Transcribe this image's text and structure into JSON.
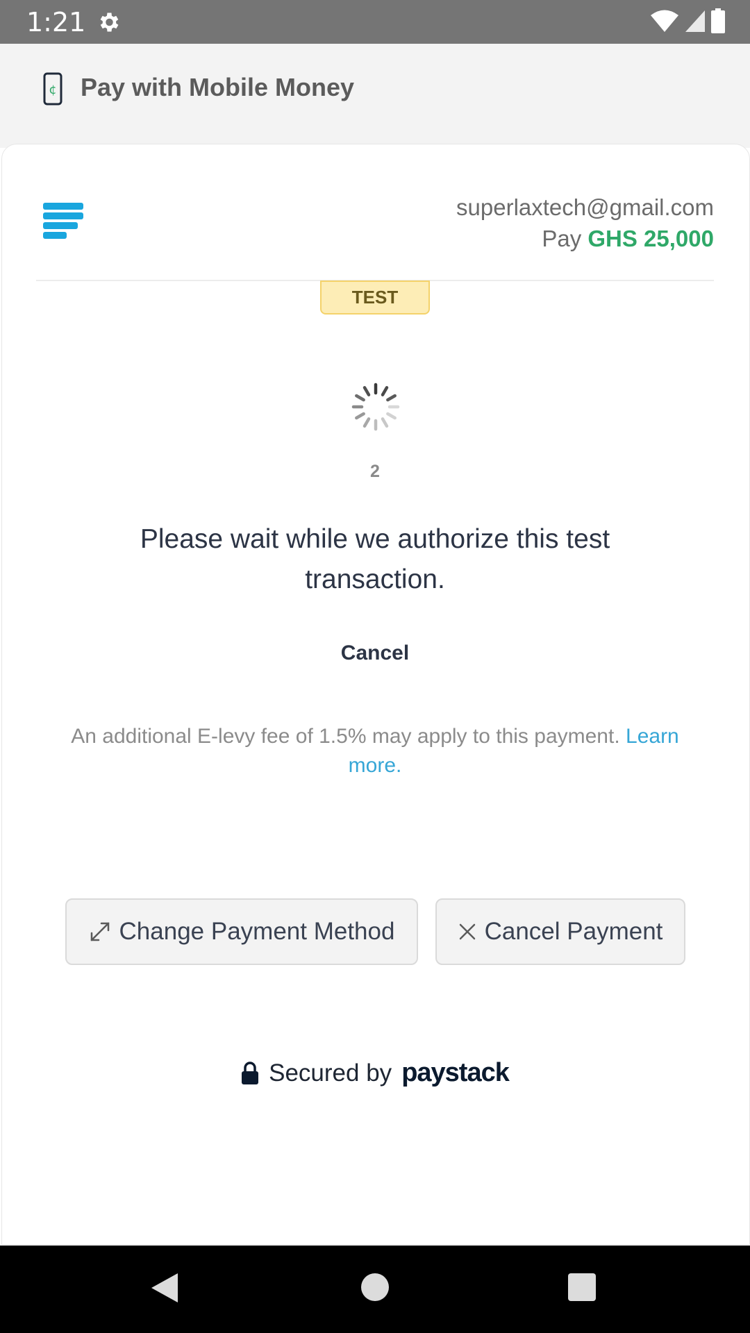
{
  "status_bar": {
    "time": "1:21"
  },
  "header": {
    "title": "Pay with Mobile Money"
  },
  "merchant": {
    "email": "superlaxtech@gmail.com",
    "pay_label": "Pay",
    "amount": "GHS 25,000"
  },
  "badge": {
    "label": "TEST"
  },
  "progress": {
    "countdown": "2"
  },
  "message": {
    "text": "Please wait while we authorize this test transaction."
  },
  "actions": {
    "cancel_label": "Cancel",
    "change_method_label": "Change Payment Method",
    "cancel_payment_label": "Cancel Payment"
  },
  "levy": {
    "text": "An additional E-levy fee of 1.5% may apply to this payment.",
    "link_label": "Learn more."
  },
  "footer": {
    "secured_label": "Secured by",
    "brand": "paystack"
  },
  "colors": {
    "amount": "#2fa868",
    "link": "#36a6d6",
    "logo": "#1aa6de"
  }
}
